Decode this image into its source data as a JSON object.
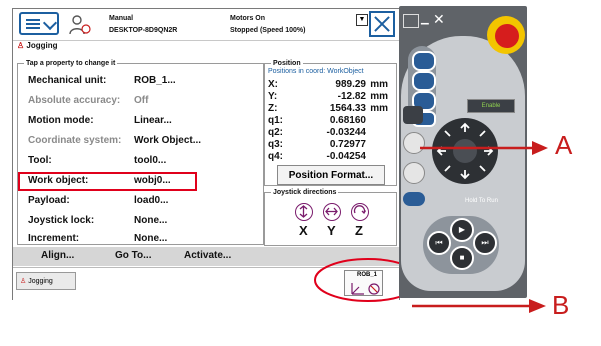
{
  "topbar": {
    "mode": "Manual",
    "host": "DESKTOP-8D9QN2R",
    "state": "Motors On",
    "speed": "Stopped (Speed 100%)"
  },
  "app_title": "Jogging",
  "properties": {
    "title": "Tap a property to change it",
    "rows": [
      {
        "label": "Mechanical unit:",
        "value": "ROB_1...",
        "dim": false
      },
      {
        "label": "Absolute accuracy:",
        "value": "Off",
        "dim": true
      },
      {
        "label": "Motion mode:",
        "value": "Linear...",
        "dim": false
      },
      {
        "label": "Coordinate system:",
        "value": "Work Object...",
        "dim": true
      },
      {
        "label": "Tool:",
        "value": "tool0...",
        "dim": false
      },
      {
        "label": "Work object:",
        "value": "wobj0...",
        "dim": false
      },
      {
        "label": "Payload:",
        "value": "load0...",
        "dim": false
      },
      {
        "label": "Joystick lock:",
        "value": "None...",
        "dim": false
      },
      {
        "label": "Increment:",
        "value": "None...",
        "dim": false
      }
    ]
  },
  "position": {
    "title": "Position",
    "subtitle": "Positions in coord: WorkObject",
    "rows": [
      {
        "k": "X:",
        "v": "989.29",
        "u": "mm"
      },
      {
        "k": "Y:",
        "v": "-12.82",
        "u": "mm"
      },
      {
        "k": "Z:",
        "v": "1564.33",
        "u": "mm"
      },
      {
        "k": "q1:",
        "v": "0.68160",
        "u": ""
      },
      {
        "k": "q2:",
        "v": "-0.03244",
        "u": ""
      },
      {
        "k": "q3:",
        "v": "0.72977",
        "u": ""
      },
      {
        "k": "q4:",
        "v": "-0.04254",
        "u": ""
      }
    ],
    "format_button": "Position Format..."
  },
  "joystick": {
    "title": "Joystick directions",
    "axes": [
      "X",
      "Y",
      "Z"
    ]
  },
  "bottom": {
    "align": "Align...",
    "goto": "Go To...",
    "activate": "Activate..."
  },
  "taskbar": {
    "tab": "Jogging",
    "quickset_unit": "ROB_1"
  },
  "pendant": {
    "enable": "Enable",
    "hold_to_run": "Hold To Run"
  },
  "annotations": {
    "a": "A",
    "b": "B"
  },
  "colors": {
    "accent": "#1c5fa0",
    "highlight": "#e0001b",
    "annotation": "#c81d1d",
    "pendant": "#5f6368",
    "estop": "#d61d1d",
    "estop_ring": "#f3c500"
  }
}
